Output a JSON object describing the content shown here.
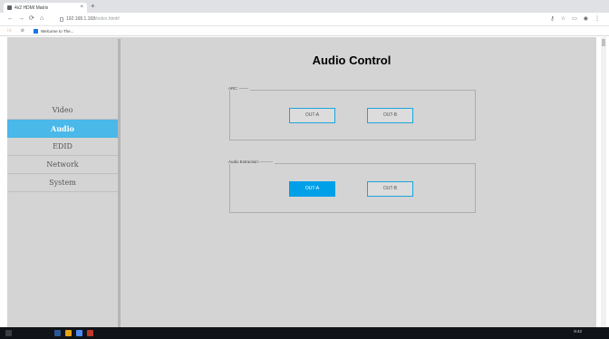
{
  "browser": {
    "tab_title": "4x2 HDMI Matrix",
    "tab_close": "×",
    "new_tab": "+",
    "nav": {
      "back": "←",
      "forward": "→",
      "reload": "⟳",
      "home": "⌂"
    },
    "url_host": "192.168.1.168",
    "url_path": "/index.html#",
    "right_icons": [
      "key-icon",
      "star-icon",
      "cast-icon",
      "extension-icon",
      "menu-icon"
    ],
    "bookmarks": {
      "apps_label": "⁝⁝⁝",
      "item_label": "Welcome to The..."
    }
  },
  "sidebar": {
    "items": [
      {
        "label": "Video",
        "active": false
      },
      {
        "label": "Audio",
        "active": true
      },
      {
        "label": "EDID",
        "active": false
      },
      {
        "label": "Network",
        "active": false
      },
      {
        "label": "System",
        "active": false
      }
    ]
  },
  "main": {
    "title": "Audio Control",
    "arc": {
      "legend": "ARC:",
      "buttons": [
        {
          "label": "OUT-A",
          "selected": false
        },
        {
          "label": "OUT-B",
          "selected": false
        }
      ]
    },
    "audio_extraction": {
      "legend": "Audio Extraction:",
      "buttons": [
        {
          "label": "OUT-A",
          "selected": true
        },
        {
          "label": "OUT-B",
          "selected": false
        }
      ]
    }
  },
  "taskbar": {
    "clock": "9:42"
  },
  "colors": {
    "accent": "#4ab8e8",
    "selected_button": "#00a0e9",
    "page_bg": "#d4d4d4"
  }
}
